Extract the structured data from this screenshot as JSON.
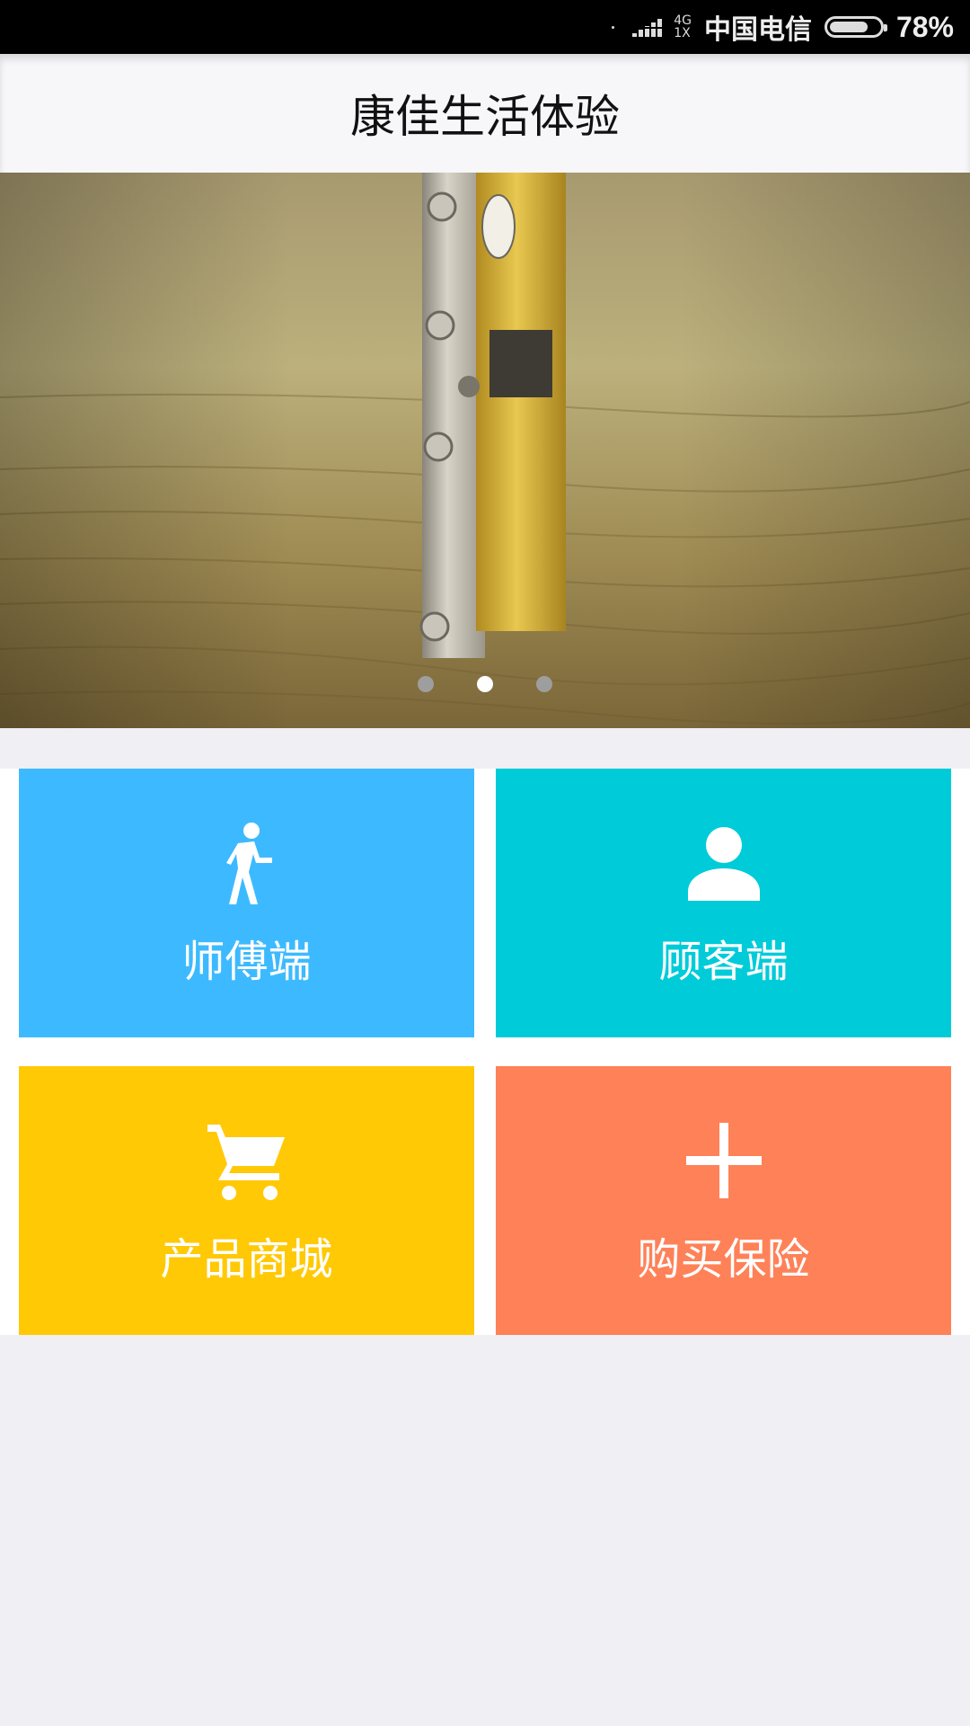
{
  "status_bar": {
    "network_top": "4G",
    "network_bottom": "1X",
    "carrier": "中国电信",
    "battery_percent": "78%",
    "battery_level": 0.78
  },
  "header": {
    "title": "康佳生活体验"
  },
  "banner": {
    "slide_count": 3,
    "active_index": 1
  },
  "tiles": [
    {
      "label": "师傅端",
      "icon": "walking-person-icon",
      "color": "#3dbaff"
    },
    {
      "label": "顾客端",
      "icon": "person-icon",
      "color": "#00cbd9"
    },
    {
      "label": "产品商城",
      "icon": "shopping-cart-icon",
      "color": "#ffc905"
    },
    {
      "label": "购买保险",
      "icon": "plus-icon",
      "color": "#ff8158"
    }
  ]
}
